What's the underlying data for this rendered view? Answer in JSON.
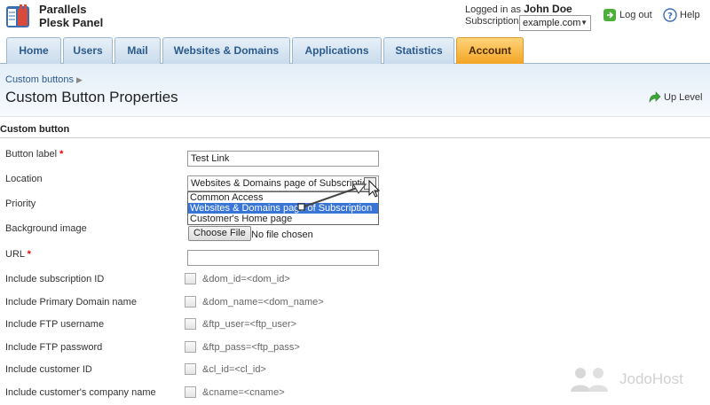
{
  "brand": {
    "line1": "Parallels",
    "line2": "Plesk Panel"
  },
  "user": {
    "logged_in_prefix": "Logged in as",
    "name": "John Doe",
    "subscription_label": "Subscription",
    "subscription_value": "example.com"
  },
  "header_links": {
    "logout": "Log out",
    "help": "Help"
  },
  "tabs": [
    {
      "label": "Home"
    },
    {
      "label": "Users"
    },
    {
      "label": "Mail"
    },
    {
      "label": "Websites & Domains"
    },
    {
      "label": "Applications"
    },
    {
      "label": "Statistics"
    },
    {
      "label": "Account"
    }
  ],
  "breadcrumb": {
    "item": "Custom buttons"
  },
  "page": {
    "title": "Custom Button Properties",
    "up_level": "Up Level"
  },
  "section": {
    "title": "Custom button"
  },
  "form": {
    "button_label": {
      "label": "Button label",
      "value": "Test Link"
    },
    "location": {
      "label": "Location",
      "selected": "Websites & Domains page of Subscription",
      "options": [
        "Common Access",
        "Websites & Domains page of Subscription",
        "Customer's Home page"
      ]
    },
    "priority": {
      "label": "Priority"
    },
    "background_image": {
      "label": "Background image",
      "button": "Choose File",
      "status": "No file chosen"
    },
    "url": {
      "label": "URL",
      "value": ""
    },
    "include_subscription_id": {
      "label": "Include subscription ID",
      "param": "&dom_id=<dom_id>"
    },
    "include_primary_domain": {
      "label": "Include Primary Domain name",
      "param": "&dom_name=<dom_name>"
    },
    "include_ftp_user": {
      "label": "Include FTP username",
      "param": "&ftp_user=<ftp_user>"
    },
    "include_ftp_pass": {
      "label": "Include FTP password",
      "param": "&ftp_pass=<ftp_pass>"
    },
    "include_customer_id": {
      "label": "Include customer ID",
      "param": "&cl_id=<cl_id>"
    },
    "include_company_name": {
      "label": "Include customer's company name",
      "param": "&cname=<cname>"
    }
  },
  "watermark": {
    "text": "JodoHost"
  },
  "colors": {
    "tab_active": "#f2a524",
    "tab_text": "#2a5a8c",
    "selection": "#3875d7",
    "required": "#e00000"
  }
}
